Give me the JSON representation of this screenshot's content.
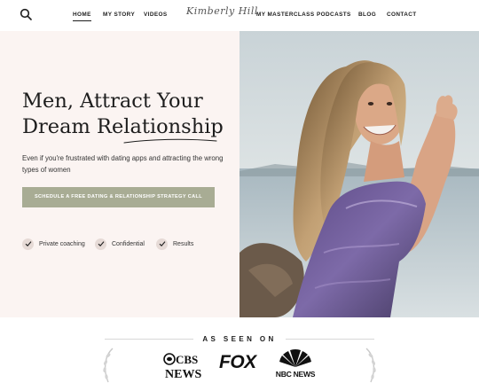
{
  "header": {
    "logo": "Kimberly Hill",
    "nav_left": [
      "HOME",
      "MY STORY",
      "VIDEOS"
    ],
    "nav_right": [
      "MY MASTERCLASS",
      "PODCASTS",
      "BLOG",
      "CONTACT"
    ],
    "search_icon": "search-icon"
  },
  "hero": {
    "headline_line1": "Men, Attract Your",
    "headline_line2": "Dream Relationship",
    "subtext": "Even if you're frustrated with dating apps and attracting the wrong types of women",
    "cta_label": "SCHEDULE A FREE DATING & RELATIONSHIP STRATEGY CALL",
    "features": [
      "Private coaching",
      "Confidential",
      "Results"
    ],
    "background_color": "#fbf4f2",
    "cta_color": "#a8ac94"
  },
  "seen_on": {
    "title": "AS SEEN ON",
    "logos": {
      "cbs_line1": "CBS",
      "cbs_line2": "NEWS",
      "fox": "FOX",
      "nbc": "NBC NEWS"
    }
  }
}
